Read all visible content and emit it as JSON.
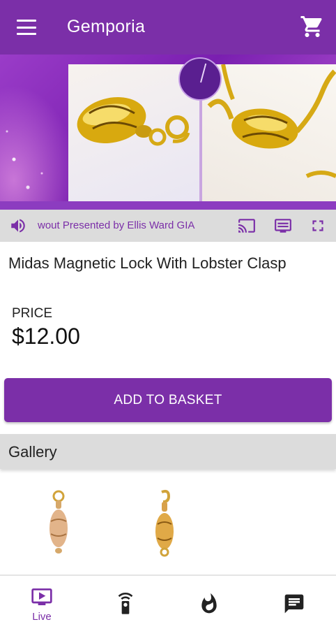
{
  "app": {
    "title": "Gemporia",
    "accent_color": "#7b2fa8"
  },
  "header": {
    "menu_icon": "hamburger-menu-icon",
    "cart_icon": "shopping-cart-icon"
  },
  "player": {
    "ticker_text": "wout Presented by Ellis Ward GIA",
    "controls": [
      "volume-icon",
      "cast-icon",
      "subtitles-icon",
      "fullscreen-icon"
    ]
  },
  "product": {
    "title": "Midas Magnetic Lock With Lobster Clasp",
    "price_label": "PRICE",
    "price": "$12.00",
    "add_to_basket_label": "ADD TO BASKET"
  },
  "gallery": {
    "title": "Gallery",
    "items": [
      "clasp-thumbnail-1",
      "clasp-thumbnail-2"
    ]
  },
  "bottom_nav": {
    "items": [
      {
        "icon": "tv-play-icon",
        "label": "Live",
        "active": true
      },
      {
        "icon": "remote-control-icon",
        "label": "",
        "active": false
      },
      {
        "icon": "flame-icon",
        "label": "",
        "active": false
      },
      {
        "icon": "chat-icon",
        "label": "",
        "active": false
      }
    ]
  }
}
